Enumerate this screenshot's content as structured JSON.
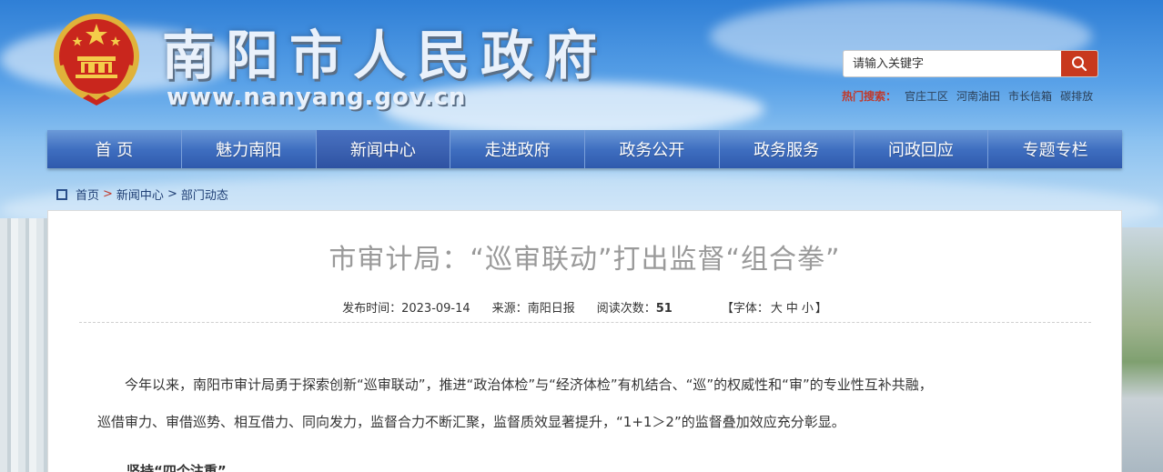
{
  "header": {
    "site_title": "南阳市人民政府",
    "site_domain": "www.nanyang.gov.cn",
    "search": {
      "placeholder": "请输入关键字"
    },
    "hot_label": "热门搜索：",
    "hot_links": [
      "官庄工区",
      "河南油田",
      "市长信箱",
      "碳排放"
    ]
  },
  "nav": {
    "items": [
      "首 页",
      "魅力南阳",
      "新闻中心",
      "走进政府",
      "政务公开",
      "政务服务",
      "问政回应",
      "专题专栏"
    ],
    "active_index": 2
  },
  "breadcrumb": {
    "items": [
      "首页",
      "新闻中心",
      "部门动态"
    ]
  },
  "article": {
    "title": "市审计局：“巡审联动”打出监督“组合拳”",
    "publish_label": "发布时间：",
    "publish_date": "2023-09-14",
    "source_label": "来源：",
    "source": "南阳日报",
    "views_label": "阅读次数：",
    "views": "51",
    "font_label_open": "【字体：",
    "font_large": "大",
    "font_medium": "中",
    "font_small": "小",
    "font_label_close": "】",
    "paragraph_1": "今年以来，南阳市审计局勇于探索创新“巡审联动”，推进“政治体检”与“经济体检”有机结合、“巡”的权威性和“审”的专业性互补共融，",
    "paragraph_2": "巡借审力、审借巡势、相互借力、同向发力，监督合力不断汇聚，监督质效显著提升，“1+1＞2”的监督叠加效应充分彰显。",
    "subhead": "坚持“四个注重”"
  },
  "colors": {
    "nav_bg": "#3f6fc0",
    "search_button": "#c8391d",
    "hot_label": "#c0392b",
    "title_gray": "#9a9a9a"
  }
}
